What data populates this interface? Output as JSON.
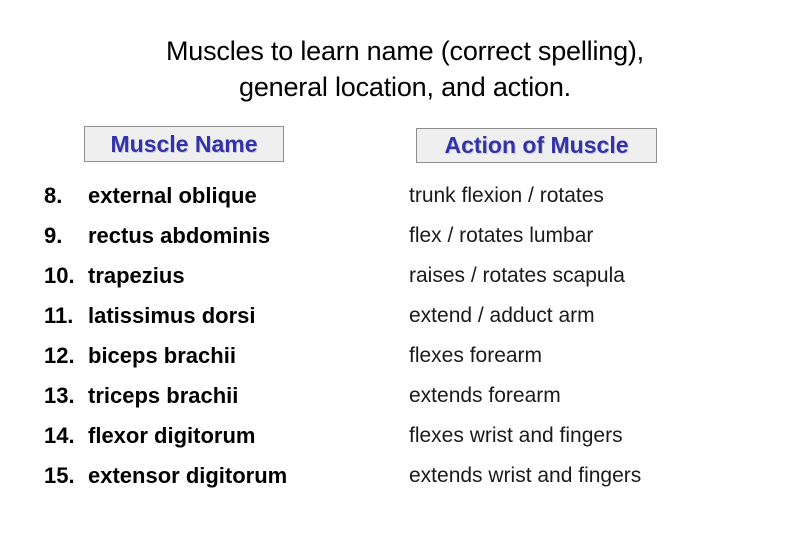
{
  "slide": {
    "title_lines": [
      "Muscles to learn name (correct spelling),",
      "general location, and action."
    ],
    "headers": {
      "muscle_name": "Muscle Name",
      "action_of_muscle": "Action of Muscle"
    },
    "colors": {
      "header_text": "#3333a8",
      "header_box_fill": "#efefef",
      "header_box_border": "#8e8e8e",
      "body_text": "#000000",
      "background": "#ffffff"
    },
    "rows": [
      {
        "number": "8.",
        "number_spaced": "8.  ",
        "muscle": "external oblique",
        "action": "trunk flexion / rotates"
      },
      {
        "number": "9.",
        "number_spaced": "9.  ",
        "muscle": "rectus abdominis",
        "action": "flex / rotates lumbar"
      },
      {
        "number": "10.",
        "number_spaced": "10.",
        "muscle": "trapezius",
        "action": "raises / rotates scapula"
      },
      {
        "number": "11.",
        "number_spaced": "11.",
        "muscle": "latissimus dorsi",
        "action": "extend / adduct arm"
      },
      {
        "number": "12.",
        "number_spaced": "12.",
        "muscle": "biceps brachii",
        "action": "flexes forearm"
      },
      {
        "number": "13.",
        "number_spaced": "13.",
        "muscle": "triceps brachii",
        "action": "extends forearm"
      },
      {
        "number": "14.",
        "number_spaced": "14.",
        "muscle": "flexor digitorum",
        "action": "flexes wrist and fingers"
      },
      {
        "number": "15.",
        "number_spaced": "15.",
        "muscle": "extensor digitorum",
        "action": "extends wrist and fingers"
      }
    ]
  }
}
